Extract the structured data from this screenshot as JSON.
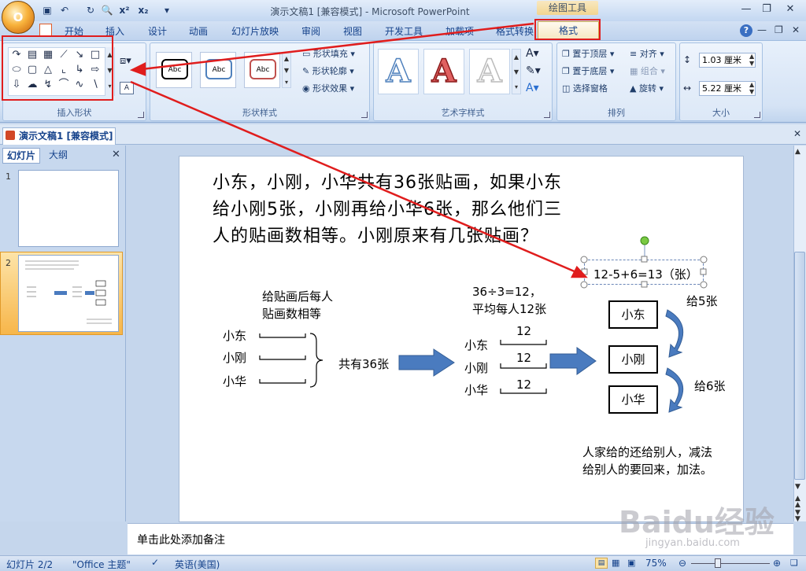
{
  "window": {
    "title": "演示文稿1 [兼容模式] - Microsoft PowerPoint",
    "context_tab_group": "绘图工具"
  },
  "orb_label": "O",
  "tabs": [
    "开始",
    "插入",
    "设计",
    "动画",
    "幻灯片放映",
    "审阅",
    "视图",
    "开发工具",
    "加载项",
    "格式转换"
  ],
  "active_tab": "格式",
  "ribbon": {
    "insert_shapes_label": "插入形状",
    "shape_styles_label": "形状样式",
    "shape_style_sample": "Abc",
    "shape_fill": "形状填充",
    "shape_outline": "形状轮廓",
    "shape_effects": "形状效果",
    "wordart_label": "艺术字样式",
    "wordart_sample": "A",
    "arrange_label": "排列",
    "bring_front": "置于顶层",
    "send_back": "置于底层",
    "selection_pane": "选择窗格",
    "align": "对齐",
    "group": "组合",
    "rotate": "旋转",
    "size_label": "大小",
    "height_value": "1.03 厘米",
    "width_value": "5.22 厘米"
  },
  "doc_tab": "演示文稿1 [兼容模式]",
  "left_pane": {
    "tab_slides": "幻灯片",
    "tab_outline": "大纲",
    "slide1_num": "1",
    "slide2_num": "2"
  },
  "slide": {
    "problem_line1": "小东，小刚，小华共有36张贴画，如果小东",
    "problem_line2": "给小刚5张，小刚再给小华6张，那么他们三",
    "problem_line3": "人的贴画数相等。小刚原来有几张贴画？",
    "equation": "12-5+6=13（张）",
    "after_label_1": "给贴画后每人",
    "after_label_2": "贴画数相等",
    "name_dong": "小东",
    "name_gang": "小刚",
    "name_hua": "小华",
    "total": "共有36张",
    "avg_1": "36÷3=12，",
    "avg_2": "平均每人12张",
    "twelve": "12",
    "give5": "给5张",
    "give6": "给6张",
    "note_1": "人家给的还给别人，减法",
    "note_2": "给别人的要回来，加法。"
  },
  "notes_placeholder": "单击此处添加备注",
  "status": {
    "slide_count": "幻灯片 2/2",
    "theme": "\"Office 主题\"",
    "language": "英语(美国)",
    "zoom": "75%"
  },
  "watermark": {
    "brand": "Baidu经验",
    "sub": "jingyan.baidu.com"
  },
  "colors": {
    "annotation_red": "#e01d1d",
    "arrow_blue": "#4a7bbf"
  }
}
